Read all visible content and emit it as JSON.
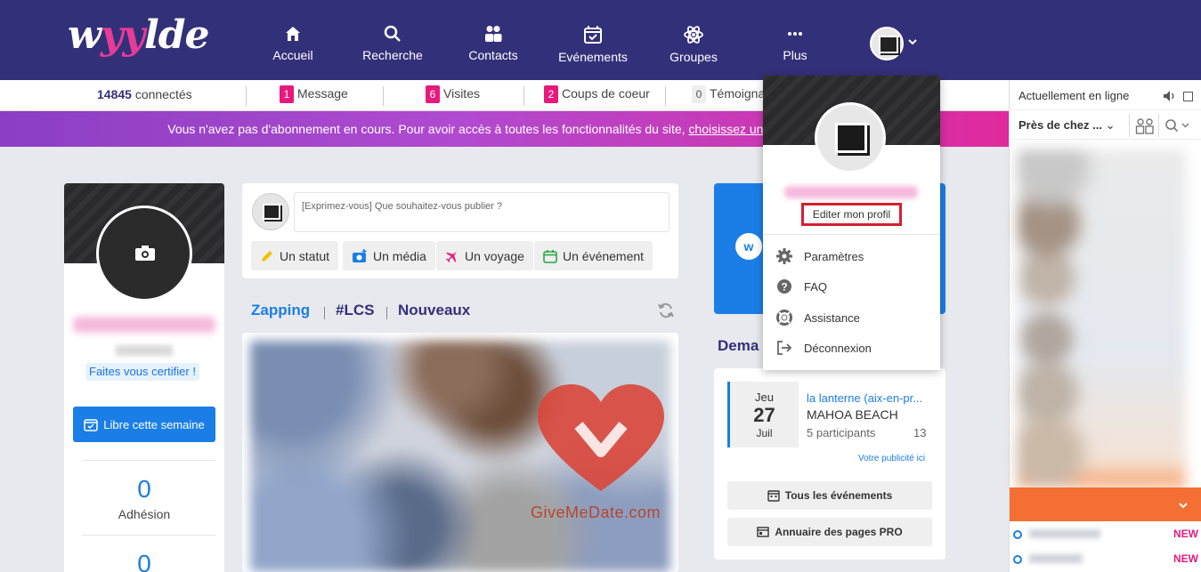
{
  "brand": {
    "logo_text_a": "w",
    "logo_text_b": "yy",
    "logo_text_c": "lde"
  },
  "nav": {
    "items": [
      {
        "label": "Accueil",
        "icon": "home-icon"
      },
      {
        "label": "Recherche",
        "icon": "search-icon"
      },
      {
        "label": "Contacts",
        "icon": "contacts-icon"
      },
      {
        "label": "Evénements",
        "icon": "calendar-icon"
      },
      {
        "label": "Groupes",
        "icon": "atom-icon"
      },
      {
        "label": "Plus",
        "icon": "more-icon"
      }
    ]
  },
  "stats": {
    "connected_count": "14845",
    "connected_label": "connectés",
    "message_count": "1",
    "message_label": "Message",
    "visits_count": "6",
    "visits_label": "Visites",
    "crush_count": "2",
    "crush_label": "Coups de coeur",
    "testimony_count": "0",
    "testimony_label": "Témoigna"
  },
  "banner": {
    "text": "Vous n'avez pas d'abonnement en cours. Pour avoir accès à toutes les fonctionnalités du site,",
    "link": "choisissez un abo"
  },
  "profile": {
    "certify_label": "Faites vous certifier !",
    "free_week_label": "Libre cette semaine",
    "counters": [
      {
        "value": "0",
        "label": "Adhésion"
      },
      {
        "value": "0",
        "label": ""
      }
    ]
  },
  "compose": {
    "placeholder": "[Exprimez-vous] Que souhaitez-vous publier ?",
    "buttons": [
      {
        "label": "Un statut",
        "icon": "pencil-icon",
        "color": "#f2c200"
      },
      {
        "label": "Un média",
        "icon": "camera-plus-icon",
        "color": "#1a7ee6"
      },
      {
        "label": "Un voyage",
        "icon": "plane-icon",
        "color": "#e6197d"
      },
      {
        "label": "Un événement",
        "icon": "calendar-icon",
        "color": "#27a844"
      }
    ]
  },
  "feed": {
    "tabs": [
      "Zapping",
      "#LCS",
      "Nouveaux"
    ]
  },
  "watermark": "GiveMeDate.com",
  "right_col": {
    "demands_title": "Dema",
    "event": {
      "day": "Jeu",
      "date": "27",
      "month": "Juil",
      "title": "la lanterne (aix-en-pr...",
      "place": "MAHOA BEACH",
      "participants": "5 participants",
      "count": "13"
    },
    "pub_link": "Votre publicité ici",
    "all_events": "Tous les événements",
    "pro_pages": "Annuaire des pages PRO"
  },
  "dropdown": {
    "edit_profile": "Editer mon profil",
    "items": [
      {
        "label": "Paramètres",
        "icon": "gear-icon"
      },
      {
        "label": "FAQ",
        "icon": "help-icon"
      },
      {
        "label": "Assistance",
        "icon": "lifebuoy-icon"
      },
      {
        "label": "Déconnexion",
        "icon": "logout-icon"
      }
    ]
  },
  "online": {
    "title": "Actuellement en ligne",
    "filter": "Près de chez ...",
    "new_badge": "NEW"
  },
  "colors": {
    "navy": "#33307a",
    "pink": "#e6197d",
    "blue": "#1a7ee6",
    "orange": "#f36f33",
    "highlight_red": "#d51f2f"
  }
}
